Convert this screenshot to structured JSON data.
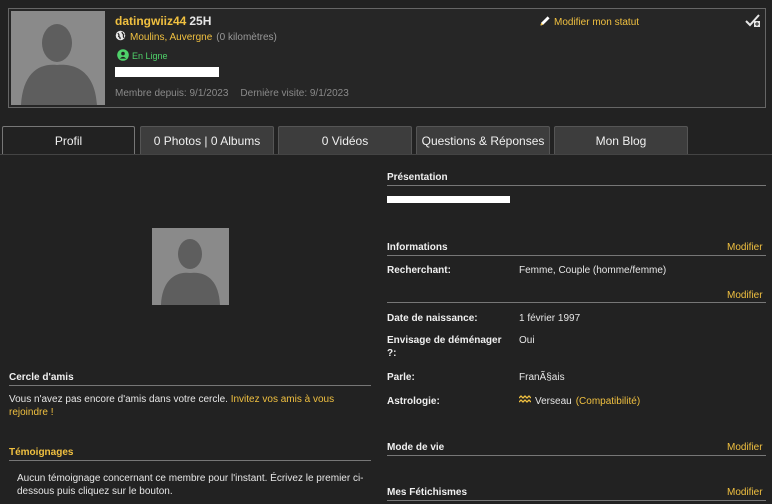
{
  "profile": {
    "username": "datingwiiz44",
    "age": "25H",
    "location": "Moulins, Auvergne",
    "distance": "(0 kilomètres)",
    "online_status": "En Ligne",
    "member_since": "Membre depuis: 9/1/2023",
    "last_visit": "Dernière visite: 9/1/2023",
    "modify_status": "Modifier mon statut"
  },
  "tabs": [
    {
      "label": "Profil",
      "active": true
    },
    {
      "label": "0 Photos | 0 Albums"
    },
    {
      "label": "0 Vidéos"
    },
    {
      "label": "Questions & Réponses"
    },
    {
      "label": "Mon Blog"
    }
  ],
  "left": {
    "friends_title": "Cercle d'amis",
    "friends_text": "Vous n'avez pas encore d'amis dans votre cercle.",
    "friends_link": "Invitez vos amis à vous rejoindre !",
    "testimonials_title": "Témoignages",
    "testimonials_text": "Aucun témoignage concernant ce membre pour l'instant. Écrivez le premier ci-dessous puis cliquez sur le bouton."
  },
  "right": {
    "presentation_title": "Présentation",
    "informations_title": "Informations",
    "modify": "Modifier",
    "seeking_label": "Recherchant:",
    "seeking_value": "Femme, Couple (homme/femme)",
    "birth_label": "Date de naissance:",
    "birth_value": "1 février 1997",
    "relocate_label": "Envisage de déménager ?:",
    "relocate_value": "Oui",
    "speaks_label": "Parle:",
    "speaks_value": "FranÃ§ais",
    "astro_label": "Astrologie:",
    "astro_value": "Verseau",
    "astro_link": "(Compatibilité)",
    "lifestyle_title": "Mode de vie",
    "fetish_title": "Mes Fétichismes"
  },
  "colors": {
    "accent": "#f0c040",
    "online": "#4fd16a",
    "background": "#222222"
  },
  "icons": [
    "globe-icon",
    "user-online-icon",
    "pencil-icon",
    "check-badge-icon",
    "aquarius-icon"
  ]
}
